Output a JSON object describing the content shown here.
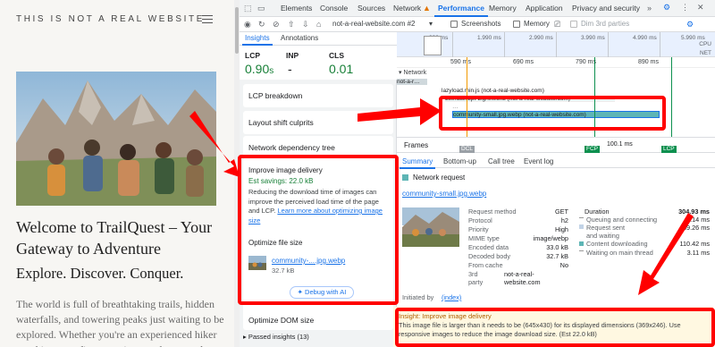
{
  "site": {
    "header": "THIS IS NOT A REAL WEBSITE",
    "title": "Welcome to TrailQuest – Your Gateway to Adventure",
    "subtitle": "Explore. Discover. Conquer.",
    "body": "The world is full of breathtaking trails, hidden waterfalls, and towering peaks just waiting to be explored. Whether you're an experienced hiker or taking your first steps into outdoor wonder,"
  },
  "devtools": {
    "tabs": [
      "Elements",
      "Console",
      "Sources",
      "Network",
      "Performance",
      "Memory",
      "Application",
      "Privacy and security"
    ],
    "toolbar": {
      "target": "not-a-real-website.com #2",
      "screenshots": "Screenshots",
      "memory": "Memory",
      "dim": "Dim 3rd parties"
    },
    "insights_tabs": [
      "Insights",
      "Annotations"
    ],
    "metrics": {
      "lcp_label": "LCP",
      "lcp_value": "0.90",
      "lcp_unit": "s",
      "inp_label": "INP",
      "inp_value": "-",
      "cls_label": "CLS",
      "cls_value": "0.01"
    },
    "cards": {
      "lcp_breakdown": "LCP breakdown",
      "layout_shift": "Layout shift culprits",
      "network_tree": "Network dependency tree",
      "dom_size": "Optimize DOM size",
      "passed": "Passed insights (13)"
    },
    "image_delivery": {
      "title": "Improve image delivery",
      "savings": "Est savings: 22.0 kB",
      "desc": "Reducing the download time of images can improve the perceived load time of the page and LCP.",
      "link": "Learn more about optimizing image size",
      "sub": "Optimize file size",
      "file_link": "community-....jpg.webp",
      "file_size": "32.7 kB",
      "button": "Debug with AI"
    },
    "ruler": {
      "labels": [
        "990 ms",
        "1.990 ms",
        "2.990 ms",
        "3.990 ms",
        "4.990 ms",
        "5.990 ms"
      ],
      "cpu": "CPU",
      "net": "NET",
      "ms": [
        "590 ms",
        "690 ms",
        "790 ms",
        "890 ms"
      ]
    },
    "network": {
      "label": "Network",
      "rows": [
        "not-a-r…",
        "lazyload.min.js (not-a-real-website.com)",
        "Literata72pt-Light.woff2 (not-a-real-website.com)",
        "…",
        "community-small.jpg.webp (not-a-real-website.com)"
      ]
    },
    "frames": {
      "label": "Frames",
      "value": "100.1 ms",
      "dcl": "DCL",
      "fcp": "FCP",
      "lcp": "LCP"
    },
    "summary_tabs": [
      "Summary",
      "Bottom-up",
      "Call tree",
      "Event log"
    ],
    "summary": {
      "heading": "Network request",
      "file": "community-small.jpg.webp",
      "fields": [
        {
          "k": "Request method",
          "v": "GET"
        },
        {
          "k": "Protocol",
          "v": "h2"
        },
        {
          "k": "Priority",
          "v": "High"
        },
        {
          "k": "MIME type",
          "v": "image/webp"
        },
        {
          "k": "Encoded data",
          "v": "33.0 kB"
        },
        {
          "k": "Decoded body",
          "v": "32.7 kB"
        },
        {
          "k": "From cache",
          "v": "No"
        },
        {
          "k": "3rd party",
          "v": "not-a-real-website.com"
        }
      ],
      "timing": [
        {
          "k": "Duration",
          "v": "304.93 ms"
        },
        {
          "k": "Queuing and connecting",
          "v": "2.14 ms"
        },
        {
          "k": "Request sent and waiting",
          "v": "89.26 ms"
        },
        {
          "k": "Content downloading",
          "v": "110.42 ms"
        },
        {
          "k": "Waiting on main thread",
          "v": "3.11 ms"
        }
      ],
      "initiated_label": "Initiated by",
      "initiated_value": "(index)"
    },
    "insight_box": {
      "title": "Insight: Improve image delivery",
      "desc": "This image file is larger than it needs to be (645x430) for its displayed dimensions (369x246). Use responsive images to reduce the image download size. (Est 22.0 kB)"
    }
  },
  "colors": {
    "accent": "#1a73e8",
    "good": "#188038",
    "annotation": "#ff0000"
  }
}
